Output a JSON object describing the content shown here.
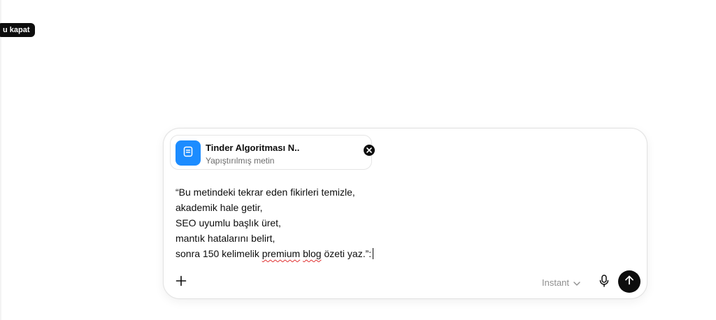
{
  "tooltip": {
    "text": "u kapat"
  },
  "attachment": {
    "title": "Tinder Algoritması N..",
    "subtitle": "Yapıştırılmış metin",
    "icon": "document-icon",
    "tile_color": "#1c8cff"
  },
  "prompt": {
    "lines": [
      "“Bu metindeki tekrar eden fikirleri temizle,",
      "akademik hale getir,",
      "SEO uyumlu başlık üret,",
      "mantık hatalarını belirt,"
    ],
    "last_line": {
      "pre": "sonra 150 kelimelik ",
      "misspelled_1": "premium",
      "space": " ",
      "misspelled_2": "blog",
      "post": " özeti yaz.”:"
    }
  },
  "toolbar": {
    "add_icon": "plus-icon",
    "model_label": "Instant",
    "model_icon": "chevron-down-icon",
    "mic_icon": "microphone-icon",
    "send_icon": "arrow-up-icon"
  },
  "colors": {
    "accent": "#1c8cff",
    "button_dark": "#0d0d0d",
    "muted_text": "#8f8f8f",
    "spellcheck": "#e03030"
  }
}
